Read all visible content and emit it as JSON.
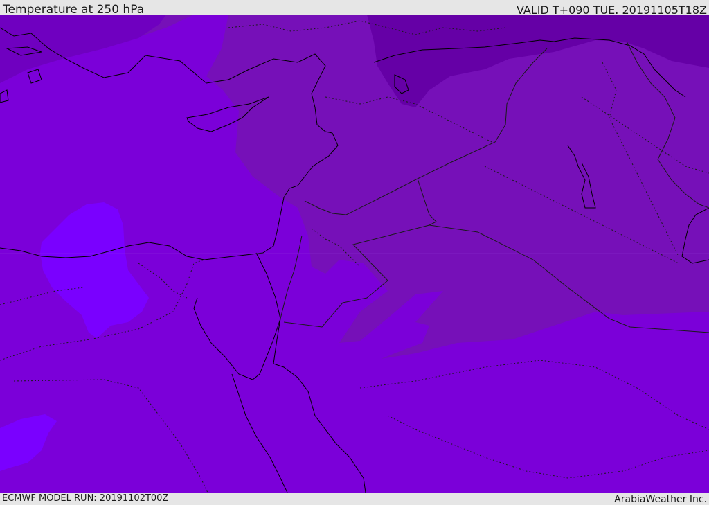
{
  "header": {
    "title": "Temperature at 250 hPa",
    "valid_time": "VALID T+090 TUE. 20191105T18Z"
  },
  "footer": {
    "model_run": "ECMWF MODEL RUN: 20191102T00Z",
    "credit": "ArabiaWeather Inc."
  },
  "colors": {
    "base_fill": "#7b00d9",
    "warm_patch": "#7a00ff",
    "cool_band": "#7610b8",
    "cold_band": "#6500a6",
    "coastline": "#000000",
    "border": "#1a1a1a"
  }
}
